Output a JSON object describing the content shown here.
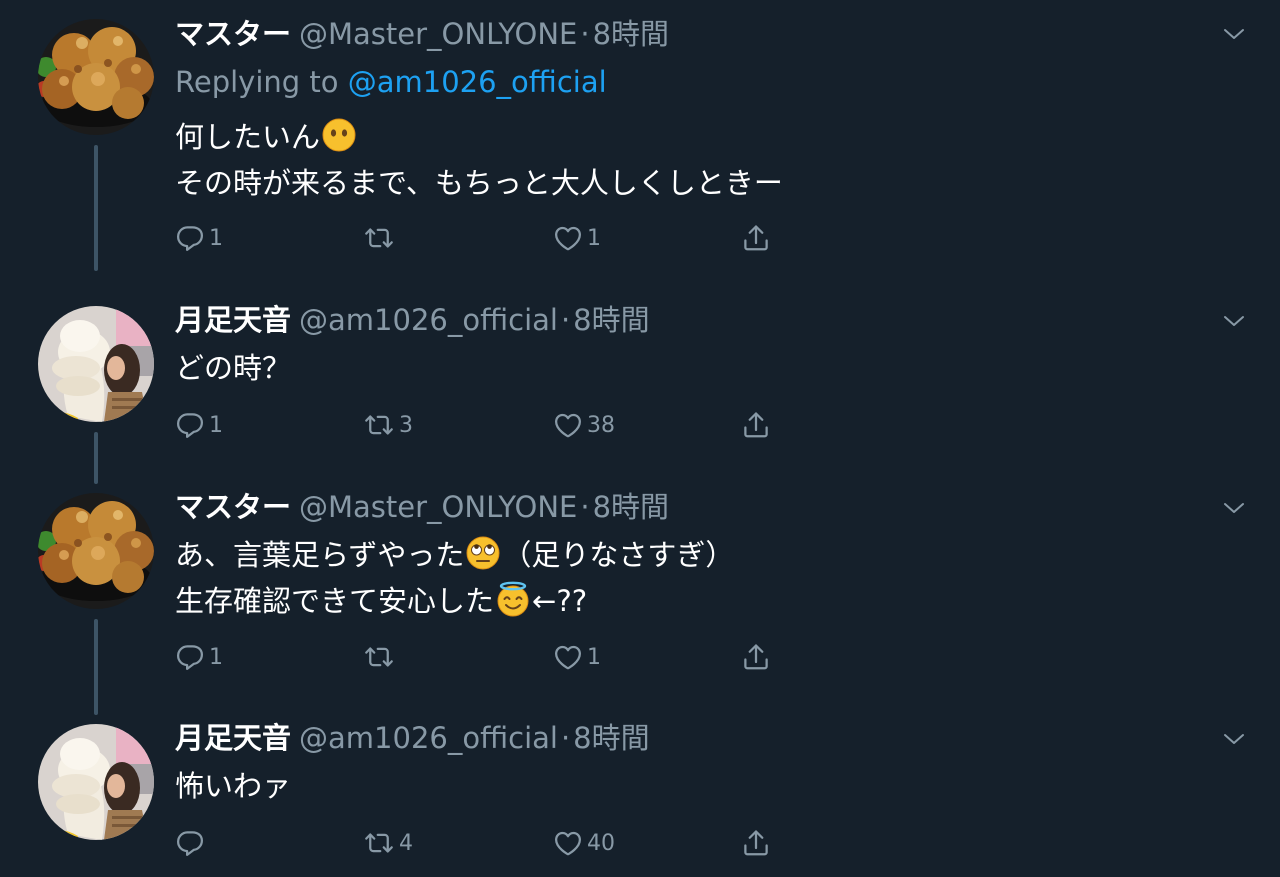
{
  "colors": {
    "background": "#15202b",
    "text": "#ffffff",
    "muted": "#8899a6",
    "link": "#1da1f2",
    "thread_line": "#3d5466"
  },
  "tweets": [
    {
      "author": "マスター",
      "handle": "@Master_ONLYONE",
      "separator": "·",
      "time": "8時間",
      "replying_prefix": "Replying to",
      "replying_to": "@am1026_official",
      "line1": "何したいん",
      "line1_emoji": "no-mouth-face-emoji",
      "line2": "その時が来るまで、もちっと大人しくしときー",
      "avatar_icon": "fried-chicken-avatar",
      "reply_count": "1",
      "retweet_count": "",
      "like_count": "1"
    },
    {
      "author": "月足天音",
      "handle": "@am1026_official",
      "separator": "·",
      "time": "8時間",
      "line1": "どの時？",
      "avatar_icon": "soft-serve-girl-avatar",
      "reply_count": "1",
      "retweet_count": "3",
      "like_count": "38"
    },
    {
      "author": "マスター",
      "handle": "@Master_ONLYONE",
      "separator": "·",
      "time": "8時間",
      "line1_a": "あ、言葉足らずやった",
      "line1_emoji": "eye-roll-face-emoji",
      "line1_b": "（足りなさすぎ）",
      "line2_a": "生存確認できて安心した",
      "line2_emoji": "halo-face-emoji",
      "line2_b": "←??",
      "avatar_icon": "fried-chicken-avatar",
      "reply_count": "1",
      "retweet_count": "",
      "like_count": "1"
    },
    {
      "author": "月足天音",
      "handle": "@am1026_official",
      "separator": "·",
      "time": "8時間",
      "line1": "怖いわァ",
      "avatar_icon": "soft-serve-girl-avatar",
      "reply_count": "",
      "retweet_count": "4",
      "like_count": "40"
    }
  ]
}
